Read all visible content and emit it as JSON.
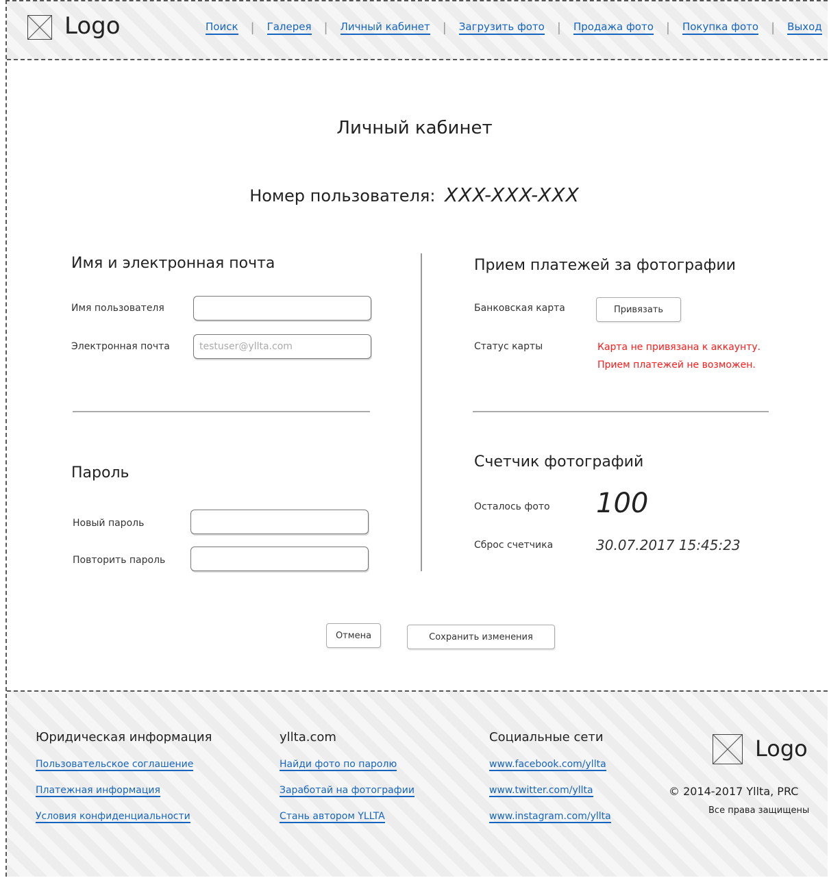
{
  "header": {
    "logo_text": "Logo",
    "nav": [
      {
        "label": "Поиск"
      },
      {
        "label": "Галерея"
      },
      {
        "label": "Личный кабинет"
      },
      {
        "label": "Загрузить фото"
      },
      {
        "label": "Продажа фото"
      },
      {
        "label": "Покупка фото"
      },
      {
        "label": "Выход"
      }
    ]
  },
  "main": {
    "title": "Личный кабинет",
    "user_number_label": "Номер пользователя:",
    "user_number_value": "XXX-XXX-XXX",
    "name_email": {
      "title": "Имя и электронная почта",
      "username_label": "Имя пользователя",
      "username_value": "",
      "email_label": "Электронная почта",
      "email_placeholder": "testuser@yllta.com"
    },
    "password": {
      "title": "Пароль",
      "new_label": "Новый пароль",
      "repeat_label": "Повторить пароль"
    },
    "payments": {
      "title": "Прием платежей за фотографии",
      "card_label": "Банковская карта",
      "bind_button": "Привязать",
      "status_label": "Статус карты",
      "status_line1": "Карта не привязана к аккаунту.",
      "status_line2": "Прием платежей не возможен.",
      "status_color": "#ff1a1a"
    },
    "counter": {
      "title": "Счетчик фотографий",
      "remaining_label": "Осталось фото",
      "remaining_value": "100",
      "reset_label": "Сброс счетчика",
      "reset_value": "30.07.2017 15:45:23"
    },
    "cancel_button": "Отмена",
    "save_button": "Сохранить изменения"
  },
  "footer": {
    "legal": {
      "title": "Юридическая информация",
      "links": [
        "Пользовательское соглашение",
        "Платежная информация",
        "Условия конфиденциальности"
      ]
    },
    "site": {
      "title": "yllta.com",
      "links": [
        "Найди фото по паролю",
        "Заработай на фотографии",
        "Стань автором YLLTA"
      ]
    },
    "social": {
      "title": "Социальные сети",
      "links": [
        "www.facebook.com/yllta",
        "www.twitter.com/yllta",
        "www.instagram.com/yllta"
      ]
    },
    "logo_text": "Logo",
    "copyright": "© 2014-2017 Yllta, PRC",
    "rights": "Все права защищены"
  },
  "colors": {
    "link": "#1565c0",
    "error": "#ff1a1a"
  }
}
